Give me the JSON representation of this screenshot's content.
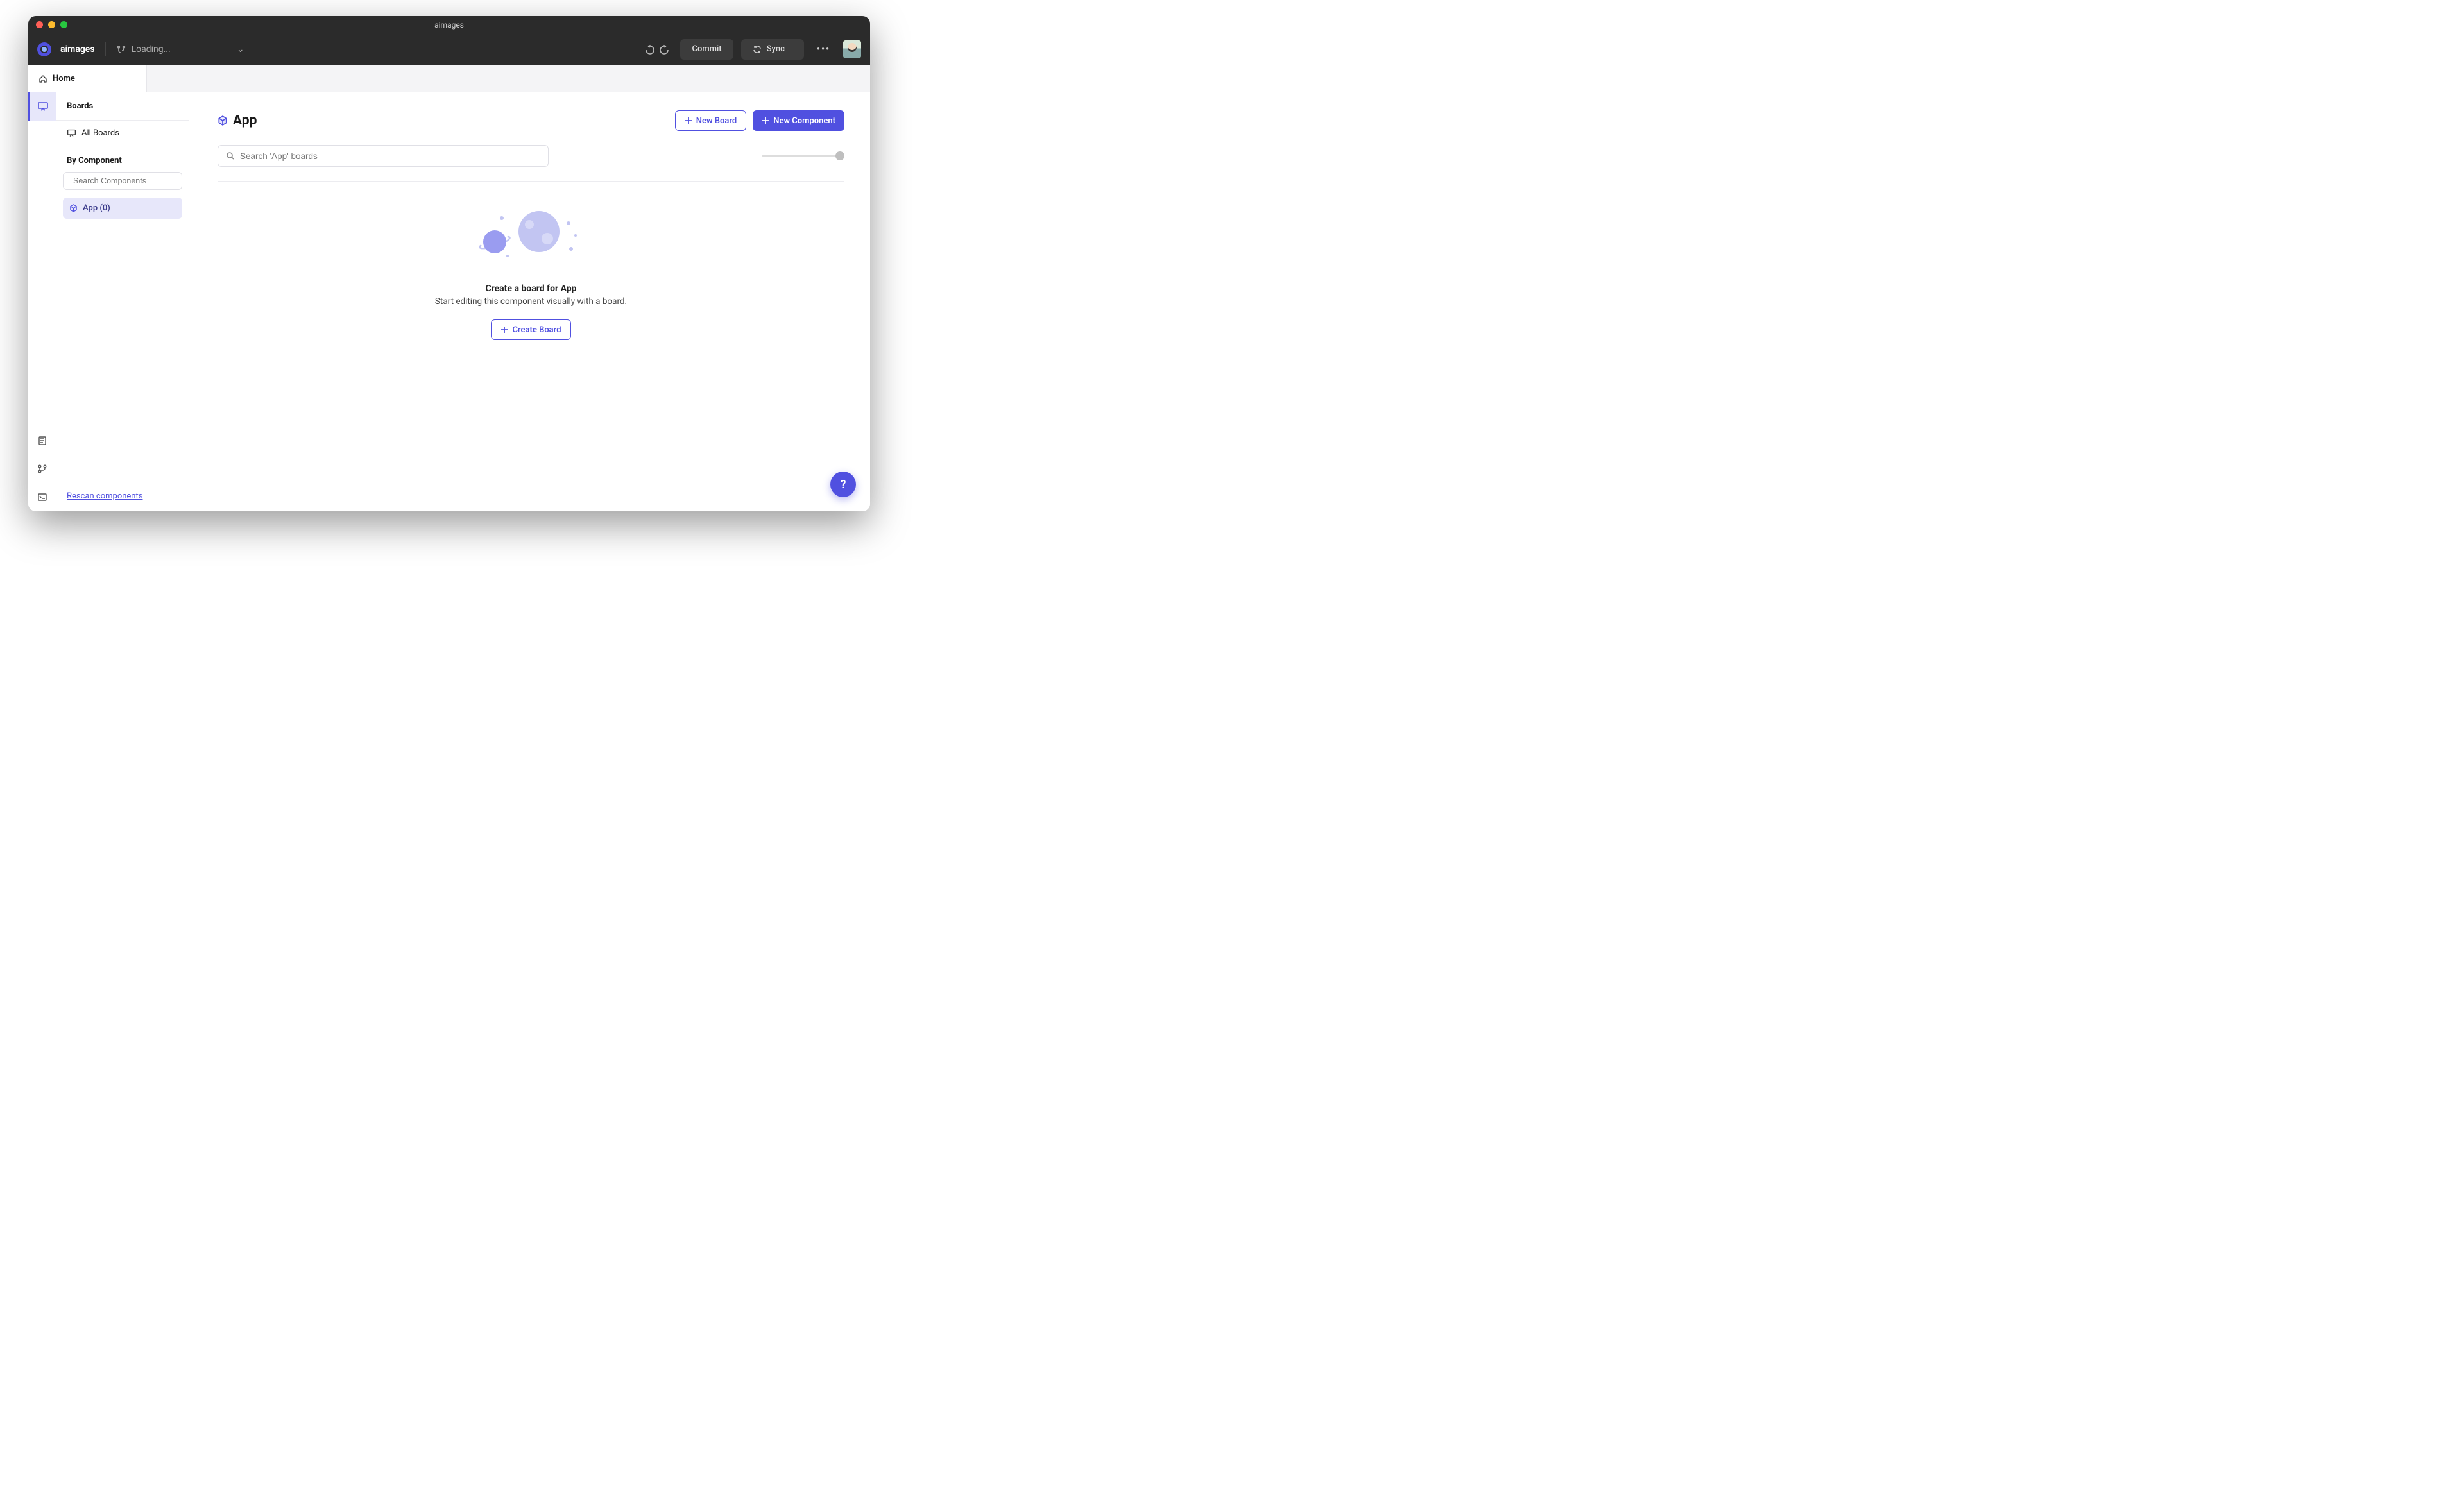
{
  "window": {
    "title": "aimages"
  },
  "topbar": {
    "project_name": "aimages",
    "branch_label": "Loading...",
    "commit_label": "Commit",
    "sync_label": "Sync"
  },
  "breadcrumb": {
    "home_label": "Home"
  },
  "sidebar": {
    "section_title": "Boards",
    "all_boards_label": "All Boards",
    "by_component_label": "By Component",
    "search_placeholder": "Search Components",
    "components": [
      {
        "name": "App",
        "count": 0
      }
    ],
    "rescan_label": "Rescan components"
  },
  "main": {
    "title": "App",
    "new_board_label": "New Board",
    "new_component_label": "New Component",
    "search_placeholder": "Search 'App' boards",
    "empty_title": "Create a board for App",
    "empty_sub": "Start editing this component visually with a board.",
    "create_board_label": "Create Board"
  },
  "help": {
    "label": "?"
  }
}
